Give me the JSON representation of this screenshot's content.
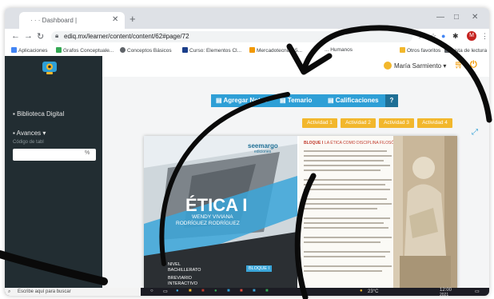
{
  "browser": {
    "tab_title": "· · · Dashboard |",
    "url": "ediq.mx/learner/content/content/62#page/72",
    "bookmarks": [
      {
        "label": "Aplicaciones",
        "color": "#4285f4"
      },
      {
        "label": "Grafos Conceptuale...",
        "color": "#34a853"
      },
      {
        "label": "Conceptos Básicos",
        "color": "#5f6368"
      },
      {
        "label": "Curso: Elementos Cl...",
        "color": "#1a3e8a"
      },
      {
        "label": "Mercadotecnia 15...",
        "color": "#f29900"
      },
      {
        "label": "... Humanos",
        "color": "#5f6368"
      },
      {
        "label": "Otros favoritos",
        "color": "#f2b72c"
      },
      {
        "label": "Lista de lectura",
        "color": "#5f6368"
      }
    ]
  },
  "sidebar": {
    "items": [
      {
        "label": "Biblioteca Digital"
      },
      {
        "label": "Avances ▾"
      }
    ],
    "code_label": "Código de tabl",
    "code_value": "%"
  },
  "header": {
    "user_name": "María Sarmiento ▾",
    "toolbar": [
      {
        "label": "Agregar Notas",
        "icon": "edit-icon"
      },
      {
        "label": "Temario",
        "icon": "list-icon"
      },
      {
        "label": "Calificaciones",
        "icon": "grades-icon"
      }
    ],
    "help": "?",
    "activities": [
      "Actividad 1",
      "Actividad 2",
      "Actividad 3",
      "Actividad 4"
    ]
  },
  "book": {
    "publisher": "seemargo",
    "publisher_sub": "ediciones",
    "title": "ÉTICA I",
    "author1": "WENDY VIVIANA",
    "author2": "RODRÍGUEZ RODRÍGUEZ",
    "level_label": "NIVEL",
    "level_value": "BACHILLERATO",
    "brev_label": "BREVIARIO",
    "brev_value": "INTERACTIVO",
    "bloque_tag": "BLOQUE I",
    "right_heading": "BLOQUE I",
    "right_heading_rest": "LA ÉTICA COMO DISCIPLINA FILOSÓFICA"
  },
  "taskbar": {
    "search_placeholder": "Escribe aquí para buscar",
    "temp": "23°C",
    "time": "12:00",
    "date": "2021"
  },
  "colors": {
    "sidebar": "#222d32",
    "toolbar": "#2e9fd6",
    "activity": "#f2b72c",
    "cover_blue": "#3ba6d9"
  }
}
